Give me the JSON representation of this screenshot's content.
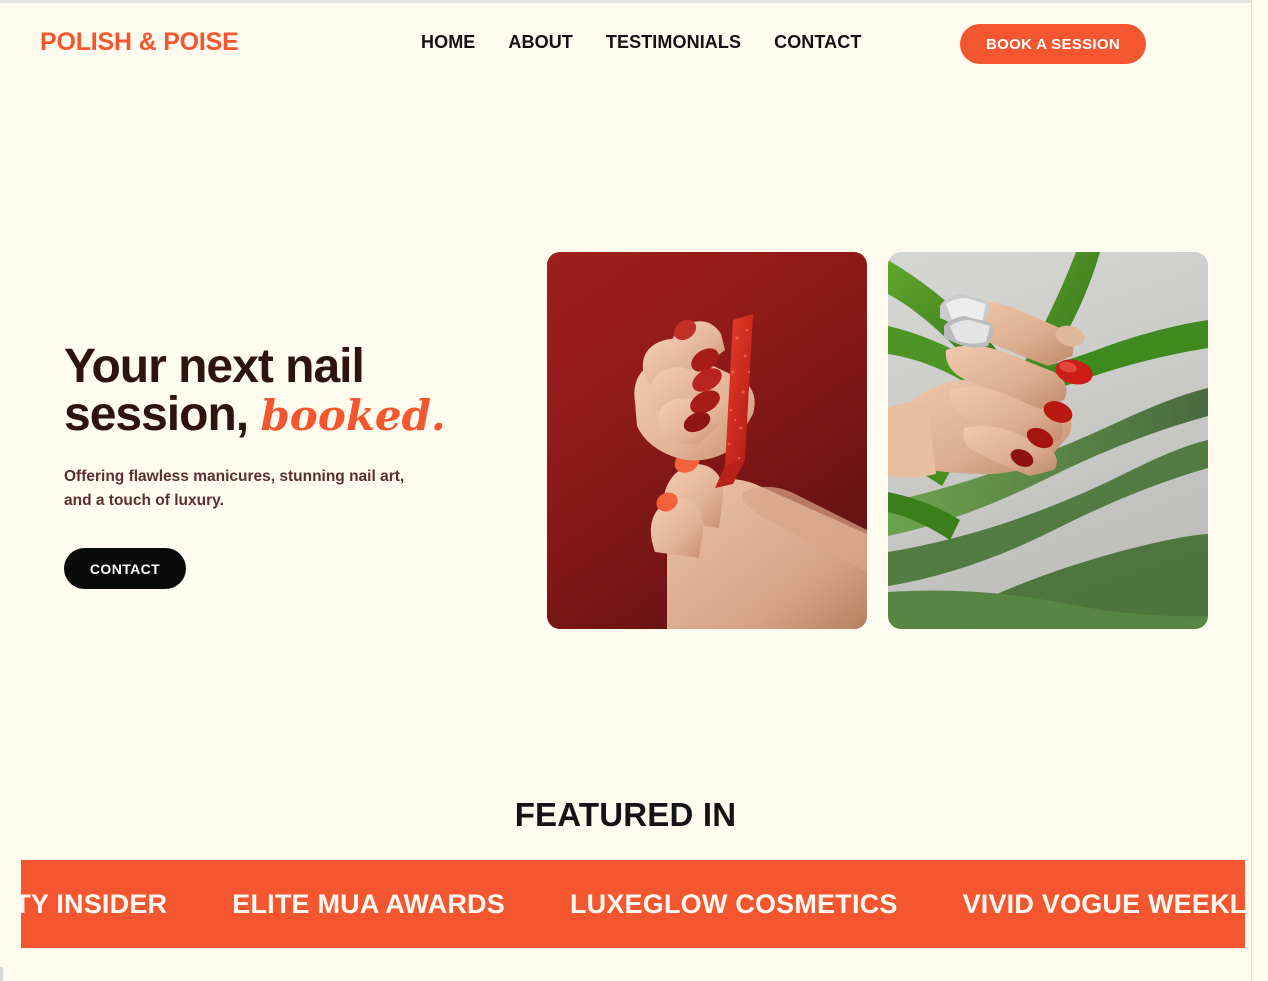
{
  "header": {
    "brand": "POLISH & POISE",
    "nav": [
      {
        "label": "HOME"
      },
      {
        "label": "ABOUT"
      },
      {
        "label": "TESTIMONIALS"
      },
      {
        "label": "CONTACT"
      }
    ],
    "cta_label": "BOOK A SESSION",
    "cta_color": "#F4562F"
  },
  "hero": {
    "title_line1": "Your next nail",
    "title_line2": "session,",
    "title_script": "booked.",
    "subtitle": "Offering flawless manicures, stunning nail art, and a touch of luxury.",
    "button_label": "CONTACT",
    "title_color": "#2E1410",
    "script_color": "#F4562F",
    "images": [
      {
        "alt": "hands-with-red-nails-holding-glitter-nail-file-on-red-background"
      },
      {
        "alt": "hand-with-silver-rings-and-red-nails-among-green-plant-leaves"
      }
    ]
  },
  "featured": {
    "title": "FEATURED IN",
    "band_color": "#F4562F",
    "items": [
      {
        "label": "L BEAUTY INSIDER"
      },
      {
        "label": "ELITE MUA AWARDS"
      },
      {
        "label": "LUXEGLOW COSMETICS"
      },
      {
        "label": "VIVID VOGUE WEEKLY"
      }
    ]
  },
  "page": {
    "background": "#FFFCEF"
  }
}
